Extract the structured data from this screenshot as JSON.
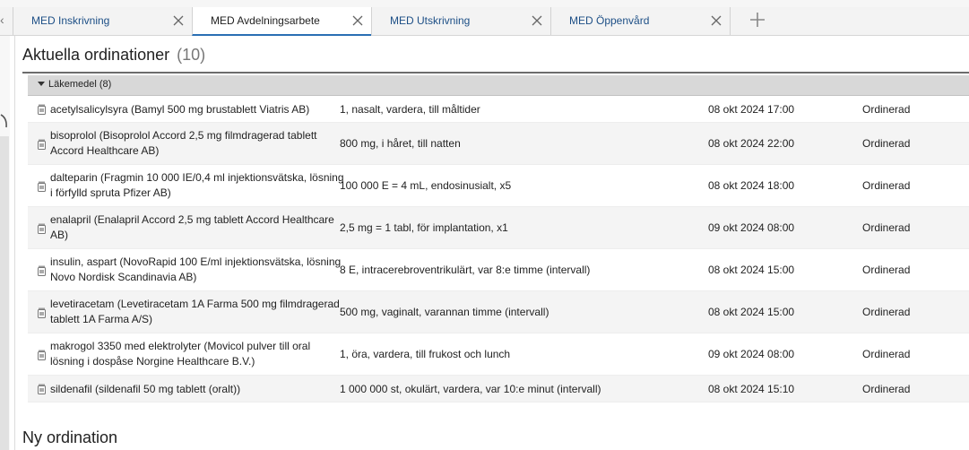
{
  "tabs": [
    {
      "label": "MED Inskrivning",
      "active": false
    },
    {
      "label": "MED Avdelningsarbete",
      "active": true
    },
    {
      "label": "MED Utskrivning",
      "active": false
    },
    {
      "label": "MED Öppenvård",
      "active": false
    }
  ],
  "section": {
    "title": "Aktuella ordinationer",
    "count": "(10)"
  },
  "group": {
    "label": "Läkemedel (8)",
    "expanded": true
  },
  "rows": [
    {
      "name": "acetylsalicylsyra (Bamyl 500 mg brustablett Viatris AB)",
      "dose": "1, nasalt, vardera, till måltider",
      "time": "08 okt 2024 17:00",
      "status": "Ordinerad"
    },
    {
      "name": "bisoprolol (Bisoprolol Accord 2,5 mg filmdragerad tablett Accord Healthcare AB)",
      "dose": "800 mg, i håret, till natten",
      "time": "08 okt 2024 22:00",
      "status": "Ordinerad"
    },
    {
      "name": "dalteparin (Fragmin 10 000 IE/0,4 ml injektionsvätska, lösning i förfylld spruta Pfizer AB)",
      "dose": "100 000 E = 4 mL, endosinusialt, x5",
      "time": "08 okt 2024 18:00",
      "status": "Ordinerad"
    },
    {
      "name": "enalapril (Enalapril Accord 2,5 mg tablett Accord Healthcare AB)",
      "dose": "2,5 mg = 1 tabl, för implantation, x1",
      "time": "09 okt 2024 08:00",
      "status": "Ordinerad"
    },
    {
      "name": "insulin, aspart (NovoRapid 100 E/ml injektionsvätska, lösning Novo Nordisk Scandinavia AB)",
      "dose": "8 E, intracerebroventrikulärt, var 8:e timme (intervall)",
      "time": "08 okt 2024 15:00",
      "status": "Ordinerad"
    },
    {
      "name": "levetiracetam (Levetiracetam 1A Farma 500 mg filmdragerad tablett 1A Farma A/S)",
      "dose": "500 mg, vaginalt, varannan timme (intervall)",
      "time": "08 okt 2024 15:00",
      "status": "Ordinerad"
    },
    {
      "name": "makrogol 3350 med elektrolyter (Movicol pulver till oral lösning i dospåse Norgine Healthcare B.V.)",
      "dose": "1, öra, vardera, till frukost och lunch",
      "time": "09 okt 2024 08:00",
      "status": "Ordinerad"
    },
    {
      "name": "sildenafil (sildenafil 50 mg tablett (oralt))",
      "dose": "1 000 000 st, okulärt, vardera, var 10:e minut (intervall)",
      "time": "08 okt 2024 15:10",
      "status": "Ordinerad"
    }
  ],
  "new_section": {
    "title": "Ny ordination"
  },
  "icons": {
    "tab_close": "close-icon",
    "tab_add": "plus-icon",
    "medication": "medication-icon",
    "group_toggle": "caret-down-icon"
  },
  "colors": {
    "tab_text": "#1d4f86",
    "active_tab_underline": "#2a6fb4",
    "group_header_bg": "#d8d8d8",
    "alt_row_bg": "#f4f4f4"
  }
}
